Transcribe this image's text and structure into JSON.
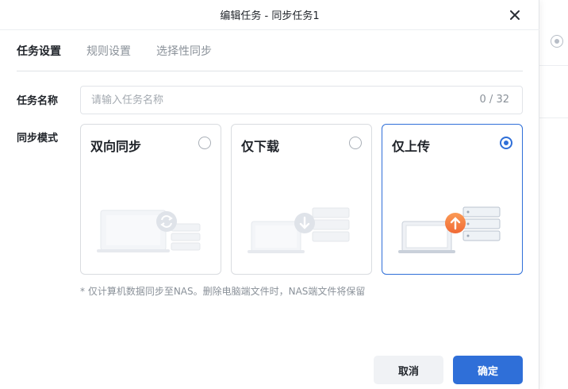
{
  "dialog": {
    "title": "编辑任务 - 同步任务1",
    "tabs": [
      {
        "label": "任务设置",
        "active": true
      },
      {
        "label": "规则设置",
        "active": false
      },
      {
        "label": "选择性同步",
        "active": false
      }
    ],
    "task_name": {
      "label": "任务名称",
      "placeholder": "请输入任务名称",
      "value": "",
      "counter": "0 / 32"
    },
    "sync_mode": {
      "label": "同步模式",
      "selected": "仅上传",
      "options": [
        {
          "label": "双向同步",
          "icon": "sync-arrows-icon",
          "checked": false
        },
        {
          "label": "仅下载",
          "icon": "download-arrow-icon",
          "checked": false
        },
        {
          "label": "仅上传",
          "icon": "upload-arrow-icon",
          "checked": true
        }
      ],
      "note": "* 仅计算机数据同步至NAS。删除电脑端文件时，NAS端文件将保留"
    },
    "buttons": {
      "cancel": "取消",
      "ok": "确定"
    }
  },
  "colors": {
    "accent": "#2f6fd8",
    "upload_badge": "#f4773e",
    "muted_text": "#8a9199"
  }
}
